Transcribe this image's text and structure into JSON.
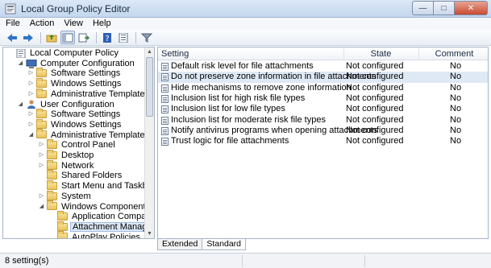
{
  "window": {
    "title": "Local Group Policy Editor"
  },
  "menu": {
    "items": [
      "File",
      "Action",
      "View",
      "Help"
    ]
  },
  "toolbar": {
    "icons": [
      "back-icon",
      "forward-icon",
      "up-folder-icon",
      "show-hide-tree-icon",
      "export-list-icon",
      "help-icon",
      "properties-icon",
      "filter-icon"
    ]
  },
  "tree": {
    "items": [
      {
        "label": "Local Computer Policy",
        "level": 0,
        "icon": "computer-policy-icon",
        "expander": ""
      },
      {
        "label": "Computer Configuration",
        "level": 1,
        "icon": "computer-icon",
        "expander": "open"
      },
      {
        "label": "Software Settings",
        "level": 2,
        "icon": "folder-icon",
        "expander": "closed"
      },
      {
        "label": "Windows Settings",
        "level": 2,
        "icon": "folder-icon",
        "expander": "closed"
      },
      {
        "label": "Administrative Templates",
        "level": 2,
        "icon": "folder-icon",
        "expander": "closed"
      },
      {
        "label": "User Configuration",
        "level": 1,
        "icon": "user-icon",
        "expander": "open"
      },
      {
        "label": "Software Settings",
        "level": 2,
        "icon": "folder-icon",
        "expander": "closed"
      },
      {
        "label": "Windows Settings",
        "level": 2,
        "icon": "folder-icon",
        "expander": "closed"
      },
      {
        "label": "Administrative Templates",
        "level": 2,
        "icon": "folder-icon",
        "expander": "open"
      },
      {
        "label": "Control Panel",
        "level": 3,
        "icon": "folder-icon",
        "expander": "closed"
      },
      {
        "label": "Desktop",
        "level": 3,
        "icon": "folder-icon",
        "expander": "closed"
      },
      {
        "label": "Network",
        "level": 3,
        "icon": "folder-icon",
        "expander": "closed"
      },
      {
        "label": "Shared Folders",
        "level": 3,
        "icon": "folder-icon",
        "expander": ""
      },
      {
        "label": "Start Menu and Taskbar",
        "level": 3,
        "icon": "folder-icon",
        "expander": ""
      },
      {
        "label": "System",
        "level": 3,
        "icon": "folder-icon",
        "expander": "closed"
      },
      {
        "label": "Windows Components",
        "level": 3,
        "icon": "folder-icon",
        "expander": "open"
      },
      {
        "label": "Application Compatibility",
        "level": 4,
        "icon": "folder-icon",
        "expander": ""
      },
      {
        "label": "Attachment Manager",
        "level": 4,
        "icon": "folder-icon",
        "expander": "",
        "selected": true
      },
      {
        "label": "AutoPlay Policies",
        "level": 4,
        "icon": "folder-icon",
        "expander": ""
      }
    ]
  },
  "list": {
    "columns": {
      "setting": "Setting",
      "state": "State",
      "comment": "Comment"
    },
    "rows": [
      {
        "setting": "Default risk level for file attachments",
        "state": "Not configured",
        "comment": "No"
      },
      {
        "setting": "Do not preserve zone information in file attachments",
        "state": "Not configured",
        "comment": "No",
        "selected": true
      },
      {
        "setting": "Hide mechanisms to remove zone information",
        "state": "Not configured",
        "comment": "No"
      },
      {
        "setting": "Inclusion list for high risk file types",
        "state": "Not configured",
        "comment": "No"
      },
      {
        "setting": "Inclusion list for low file types",
        "state": "Not configured",
        "comment": "No"
      },
      {
        "setting": "Inclusion list for moderate risk file types",
        "state": "Not configured",
        "comment": "No"
      },
      {
        "setting": "Notify antivirus programs when opening attachments",
        "state": "Not configured",
        "comment": "No"
      },
      {
        "setting": "Trust logic for file attachments",
        "state": "Not configured",
        "comment": "No"
      }
    ]
  },
  "tabs": [
    {
      "label": "Extended"
    },
    {
      "label": "Standard",
      "active": true
    }
  ],
  "status": {
    "text": "8 setting(s)"
  },
  "colors": {
    "selection": "#dde8f6",
    "titlebar": "#c3d7ee",
    "folder": "#e9c25a"
  }
}
